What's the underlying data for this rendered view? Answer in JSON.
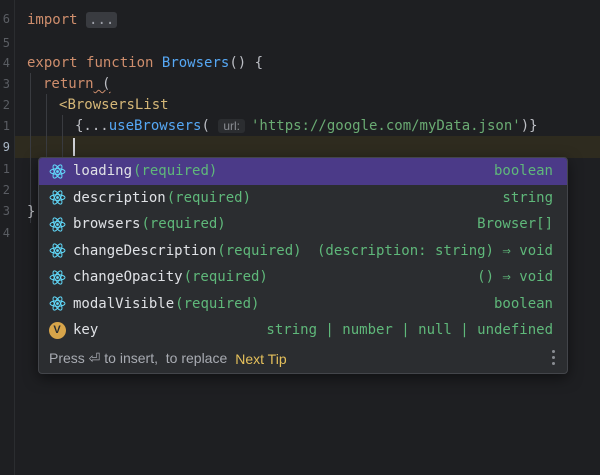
{
  "editor": {
    "line_numbers": [
      "6",
      "5",
      "4",
      "3",
      "2",
      "1",
      "9",
      "1",
      "2",
      "3",
      "4"
    ],
    "lines": {
      "import_kw": "import",
      "import_fold": "...",
      "export_kw": "export",
      "function_kw": "function",
      "fn_name": "Browsers",
      "fn_rest": "() {",
      "return_kw": "return",
      "return_rest": " (",
      "tag_open": "<",
      "tag_name": "BrowsersList",
      "expr_open": "{...",
      "hook_name": "useBrowsers",
      "paren_open": "(",
      "param_hint": "url:",
      "url_string": "'https://google.com/myData.json'",
      "expr_close": ")}",
      "close_brace": "}"
    }
  },
  "completion": {
    "items": [
      {
        "name": "loading",
        "required": "(required)",
        "type": "boolean",
        "icon": "react-icon",
        "selected": true
      },
      {
        "name": "description",
        "required": "(required)",
        "type": "string",
        "icon": "react-icon"
      },
      {
        "name": "browsers",
        "required": "(required)",
        "type": "Browser[]",
        "icon": "react-icon"
      },
      {
        "name": "changeDescription",
        "required": "(required)",
        "type": "(description: string) ⇒ void",
        "icon": "react-icon"
      },
      {
        "name": "changeOpacity",
        "required": "(required)",
        "type": "() ⇒ void",
        "icon": "react-icon"
      },
      {
        "name": "modalVisible",
        "required": "(required)",
        "type": "boolean",
        "icon": "react-icon"
      },
      {
        "name": "key",
        "required": "",
        "type": "string | number | null | undefined",
        "icon": "variable-icon",
        "badge": "V"
      }
    ],
    "footer": {
      "text": "Press ⏎ to insert,  to replace",
      "next_tip": "Next Tip"
    }
  },
  "colors": {
    "editor_bg": "#1e1f22",
    "popup_bg": "#2b2d30",
    "selection": "#4b3a88",
    "keyword": "#cf8e6d",
    "function": "#56a8f5",
    "tag": "#d5b778",
    "string": "#6aab73",
    "type": "#5fb87a",
    "tip": "#e5c05b"
  }
}
